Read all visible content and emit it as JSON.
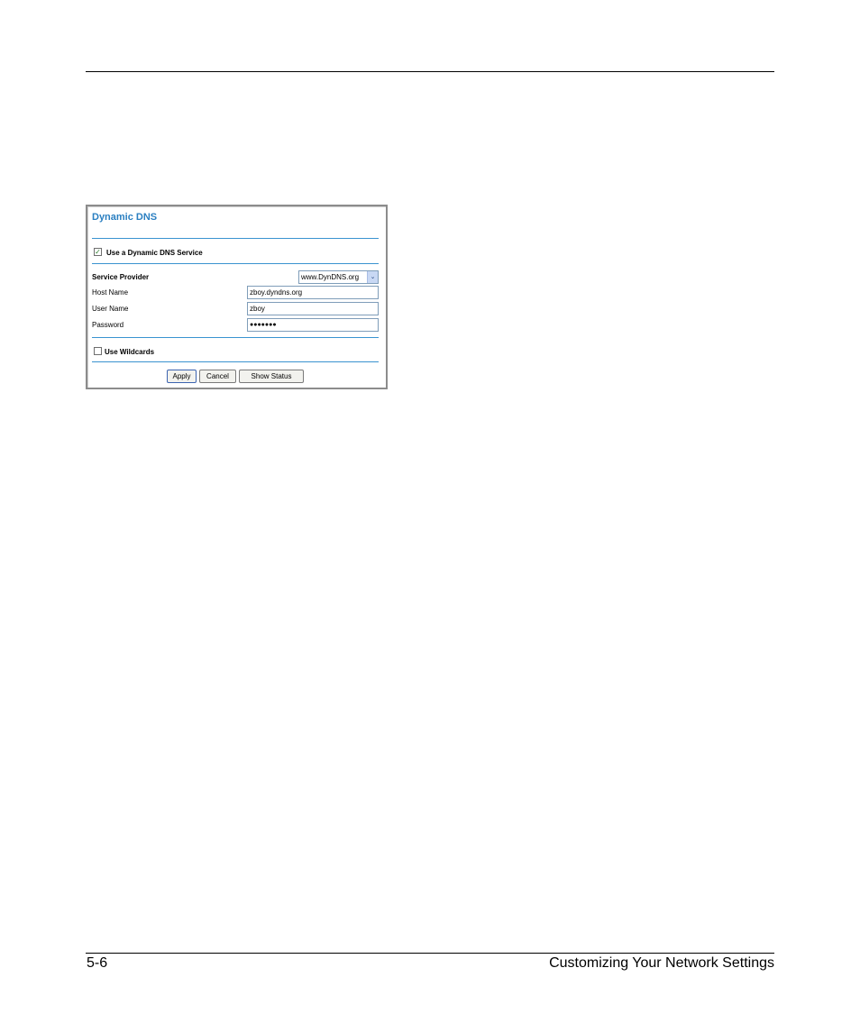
{
  "footer": {
    "page_number": "5-6",
    "section_title": "Customizing Your Network Settings"
  },
  "dyndns": {
    "title": "Dynamic DNS",
    "use_service_label": "Use a Dynamic DNS Service",
    "use_service_checked": true,
    "service_provider_label": "Service Provider",
    "service_provider_value": "www.DynDNS.org",
    "host_name_label": "Host Name",
    "host_name_value": "zboy.dyndns.org",
    "user_name_label": "User Name",
    "user_name_value": "zboy",
    "password_label": "Password",
    "password_value": "●●●●●●●",
    "use_wildcards_label": "Use Wildcards",
    "use_wildcards_checked": false,
    "apply_label": "Apply",
    "cancel_label": "Cancel",
    "show_status_label": "Show Status",
    "checkmark_icon": "✓",
    "dropdown_icon": "⌄"
  }
}
